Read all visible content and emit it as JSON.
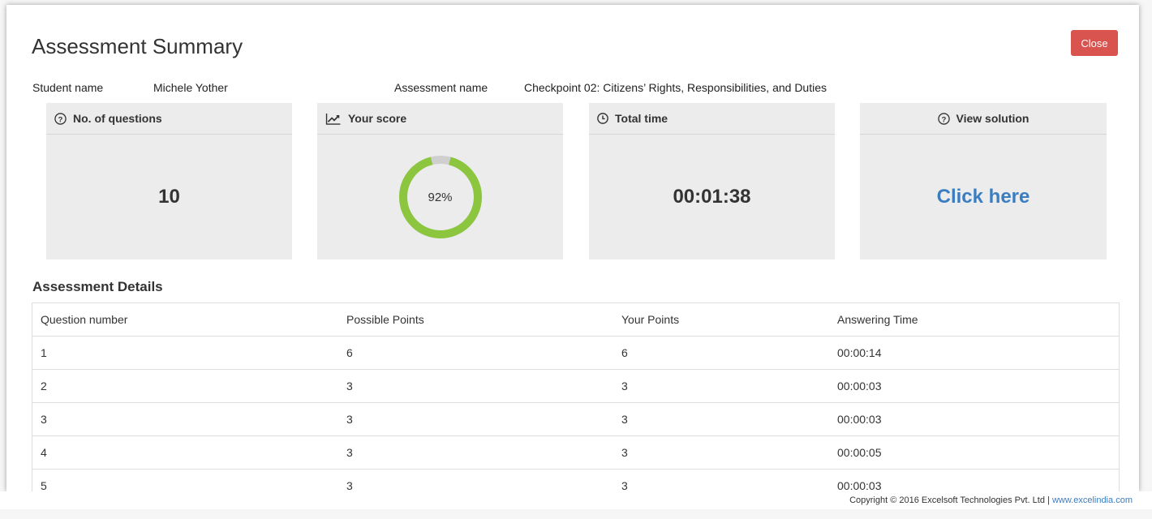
{
  "title": "Assessment Summary",
  "close_label": "Close",
  "student": {
    "label": "Student name",
    "value": "Michele Yother"
  },
  "assessment": {
    "label": "Assessment name",
    "value": "Checkpoint 02: Citizens’ Rights, Responsibilities, and Duties"
  },
  "cards": {
    "questions": {
      "label": "No. of questions",
      "value": "10",
      "icon": "question-circle-icon"
    },
    "score": {
      "label": "Your score",
      "value": "92%",
      "percent": 92,
      "icon": "line-chart-icon"
    },
    "time": {
      "label": "Total time",
      "value": "00:01:38",
      "icon": "clock-icon"
    },
    "solution": {
      "label": "View solution",
      "value": "Click here",
      "icon": "question-circle-icon"
    }
  },
  "details_title": "Assessment Details",
  "table": {
    "headers": [
      "Question number",
      "Possible Points",
      "Your Points",
      "Answering Time"
    ],
    "rows": [
      [
        "1",
        "6",
        "6",
        "00:00:14"
      ],
      [
        "2",
        "3",
        "3",
        "00:00:03"
      ],
      [
        "3",
        "3",
        "3",
        "00:00:03"
      ],
      [
        "4",
        "3",
        "3",
        "00:00:05"
      ],
      [
        "5",
        "3",
        "3",
        "00:00:03"
      ]
    ]
  },
  "footer": {
    "copyright": "Copyright © 2016 Excelsoft Technologies Pvt. Ltd |",
    "link": "www.excelindia.com"
  },
  "colors": {
    "close_button": "#d9534f",
    "score_ring": "#8cc63f",
    "score_ring_rest": "#cfcfcf",
    "link": "#3a7ec1",
    "card_bg": "#ececec"
  }
}
